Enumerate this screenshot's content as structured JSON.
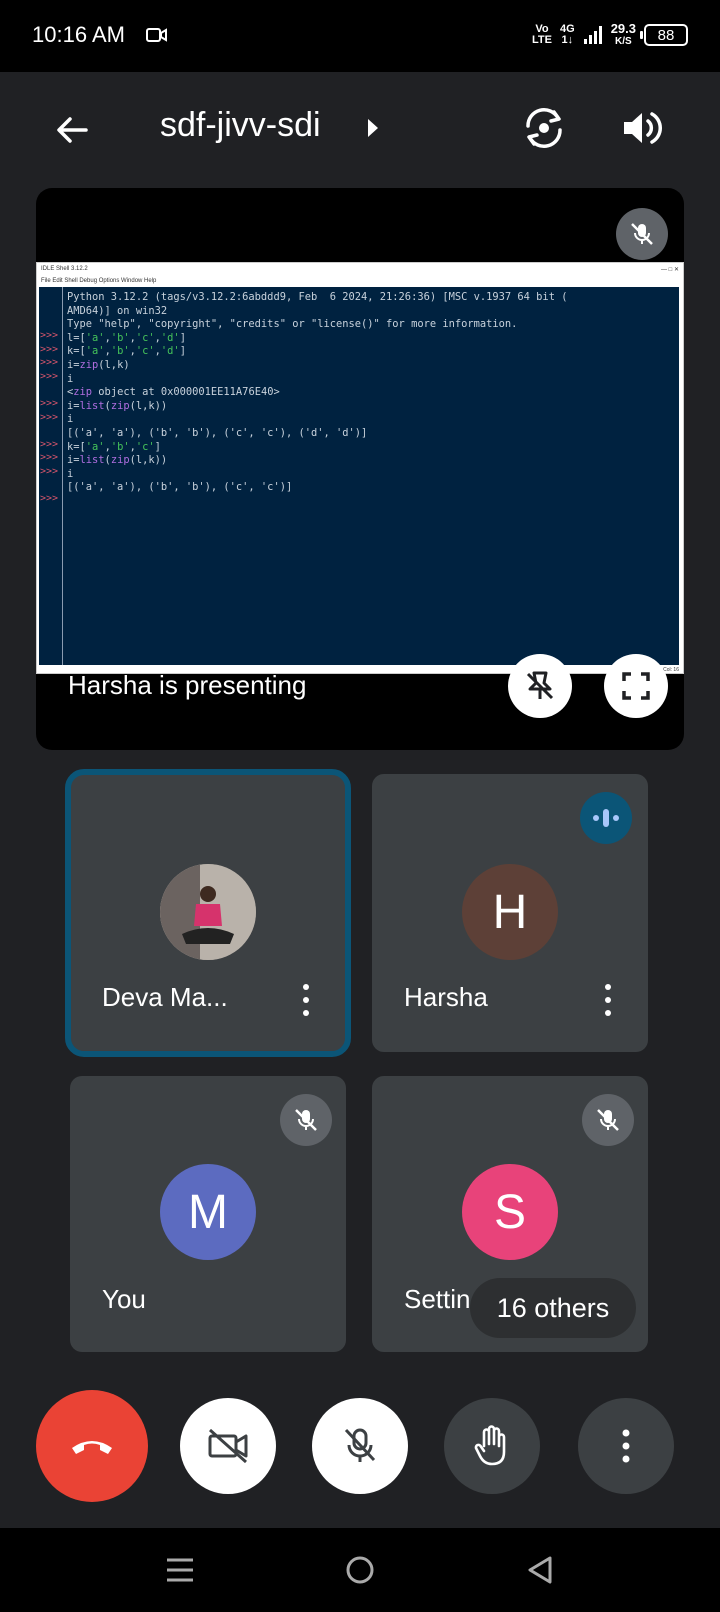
{
  "status_bar": {
    "time": "10:16 AM",
    "network_top": "Vo",
    "network_bottom": "LTE",
    "gen_top": "4G",
    "gen_bottom": "1↓",
    "speed_value": "29.3",
    "speed_unit": "K/S",
    "battery": "88"
  },
  "header": {
    "meeting_code": "sdf-jivv-sdi"
  },
  "presentation": {
    "label": "Harsha is presenting",
    "window_title": "IDLE Shell 3.12.2",
    "window_controls": "—  □  ✕",
    "menu": "File   Edit   Shell   Debug   Options   Window   Help",
    "status_corner": "Ln: 12  Col: 16",
    "prompts": ">>>\n>>>\n>>>\n>>>\n\n>>>\n>>>\n\n>>>\n>>>\n>>>\n\n>>>",
    "lines": [
      "Python 3.12.2 (tags/v3.12.2:6abddd9, Feb  6 2024, 21:26:36) [MSC v.1937 64 bit (",
      "AMD64)] on win32",
      "Type \"help\", \"copyright\", \"credits\" or \"license()\" for more information.",
      "l=['a','b','c','d']",
      "k=['a','b','c','d']",
      "i=zip(l,k)",
      "i",
      "<zip object at 0x000001EE11A76E40>",
      "i=list(zip(l,k))",
      "i",
      "[('a', 'a'), ('b', 'b'), ('c', 'c'), ('d', 'd')]",
      "k=['a','b','c']",
      "i=list(zip(l,k))",
      "i",
      "[('a', 'a'), ('b', 'b'), ('c', 'c')]"
    ]
  },
  "participants": [
    {
      "name": "Deva Ma...",
      "avatar": "photo",
      "state": "active"
    },
    {
      "name": "Harsha",
      "initial": "H",
      "color": "#5d4037",
      "state": "speaking"
    },
    {
      "name": "You",
      "initial": "M",
      "color": "#5c6bc0",
      "state": "muted"
    },
    {
      "name": "Settin",
      "initial": "S",
      "color": "#e8437a",
      "state": "muted"
    }
  ],
  "others_label": "16 others",
  "controls": [
    "end-call",
    "camera-off",
    "mic-off",
    "raise-hand",
    "more-options"
  ],
  "colors": {
    "end_call": "#ea4335",
    "active_outline": "#0b5577",
    "tile_bg": "#3c4043"
  }
}
